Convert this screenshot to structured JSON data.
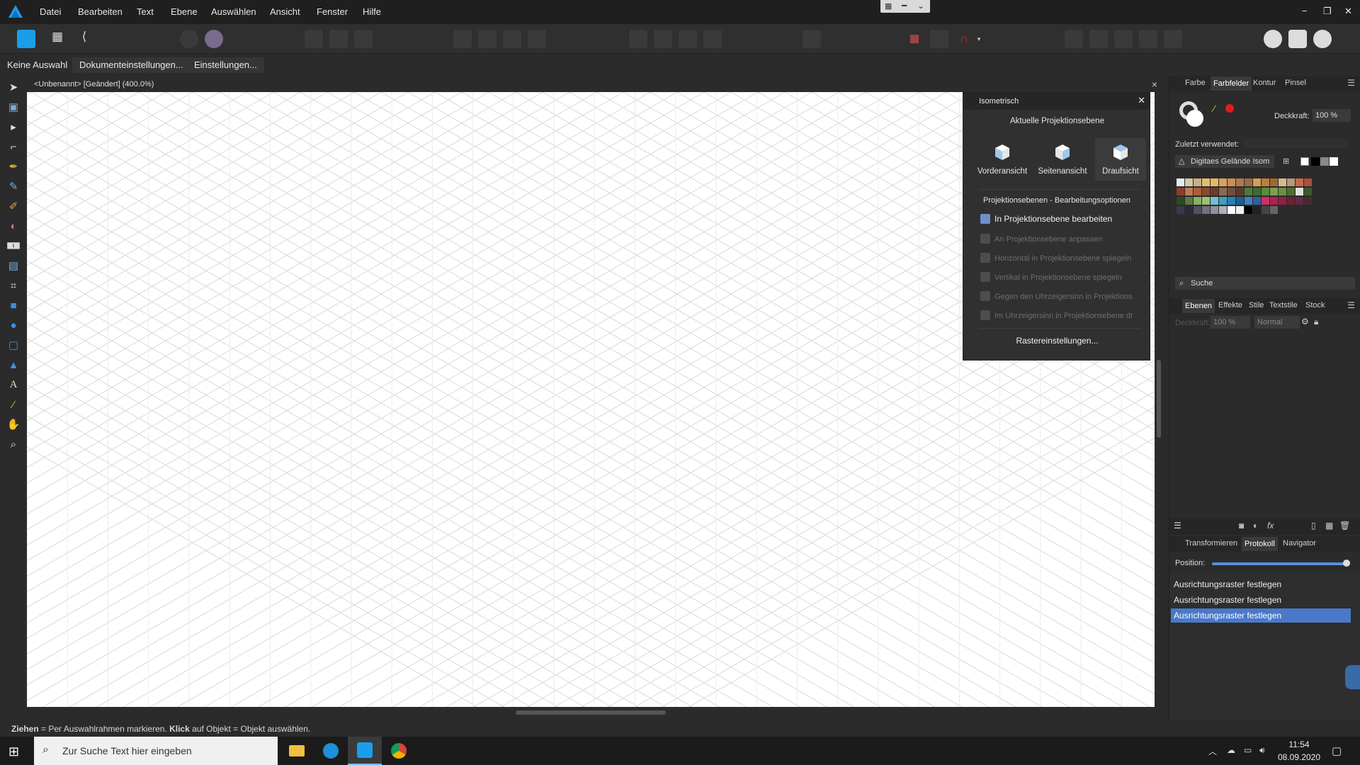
{
  "menu": {
    "items": [
      "Datei",
      "Bearbeiten",
      "Text",
      "Ebene",
      "Auswählen",
      "Ansicht",
      "Fenster",
      "Hilfe"
    ]
  },
  "window_controls": {
    "minimize": "−",
    "restore": "❐",
    "close": "✕"
  },
  "context_bar": {
    "selection": "Keine Auswahl",
    "document_settings": "Dokumenteinstellungen...",
    "settings": "Einstellungen..."
  },
  "document": {
    "title": "<Unbenannt> [Geändert] (400.0%)"
  },
  "isometric_panel": {
    "title": "Isometrisch",
    "current_plane_heading": "Aktuelle Projektionsebene",
    "views": [
      "Vorderansicht",
      "Seitenansicht",
      "Draufsicht"
    ],
    "active_view": "Draufsicht",
    "options_heading": "Projektionsebenen - Bearbeitungsoptionen",
    "options": [
      "In Projektionsebene bearbeiten",
      "An Projektionsebene anpassen",
      "Horizontal in Projektionsebene spiegeln",
      "Vertikal in Projektionsebene spiegeln",
      "Gegen den Uhrzeigersinn in Projektions",
      "Im Uhrzeigersinn in Projektionsebene dr"
    ],
    "grid_settings_button": "Rastereinstellungen..."
  },
  "color_panel": {
    "tabs": [
      "Farbe",
      "Farbfelder",
      "Kontur",
      "Pinsel"
    ],
    "active_tab": "Farbfelder",
    "opacity_label": "Deckkraft:",
    "opacity_value": "100 %",
    "recent_label": "Zuletzt verwendet:",
    "palette_name": "Digitaes Gelände Isom",
    "search_placeholder": "Suche",
    "accent_color": "#e31b1b"
  },
  "layers_panel": {
    "tabs": [
      "Ebenen",
      "Effekte",
      "Stile",
      "Textstile",
      "Stock"
    ],
    "active_tab": "Ebenen",
    "opacity_label": "Deckkraft:",
    "opacity_value": "100 %",
    "blend_mode": "Normal"
  },
  "history_panel": {
    "tabs": [
      "Transformieren",
      "Protokoll",
      "Navigator"
    ],
    "active_tab": "Protokoll",
    "position_label": "Position:",
    "position_value": 1.0,
    "items": [
      "Ausrichtungsraster festlegen",
      "Ausrichtungsraster festlegen",
      "Ausrichtungsraster festlegen"
    ],
    "selected_index": 2
  },
  "status_bar": {
    "part1_bold": "Ziehen",
    "part2": " = Per Auswahlrahmen markieren. ",
    "part3_bold": "Klick",
    "part4": " auf Objekt = Objekt auswählen."
  },
  "taskbar": {
    "search_placeholder": "Zur Suche Text hier eingeben",
    "time": "11:54",
    "date": "08.09.2020"
  },
  "colors": {
    "accent_blue": "#4a79c9",
    "canvas": "#ffffff",
    "grid_line": "#d9d9d9"
  }
}
